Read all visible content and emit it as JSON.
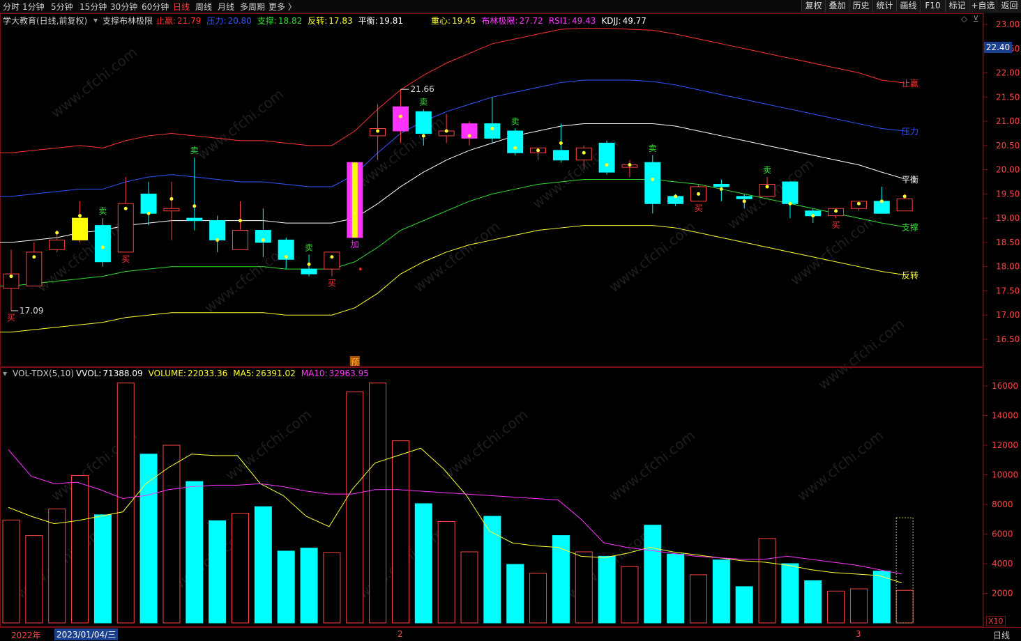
{
  "toolbar": {
    "periods": [
      "分时",
      "1分钟",
      "5分钟",
      "15分钟",
      "30分钟",
      "60分钟",
      "日线",
      "周线",
      "月线",
      "多周期",
      "更多 〉"
    ],
    "active_period": "日线",
    "right_buttons": [
      "复权",
      "叠加",
      "历史",
      "统计",
      "画线",
      "F10",
      "标记",
      "+自选",
      "返回"
    ]
  },
  "main_info": {
    "stock": "学大教育(日线,前复权)",
    "indicator": "支撑布林极限",
    "items": [
      {
        "label": "止赢:",
        "value": "21.79",
        "color": "#ff3333"
      },
      {
        "label": "压力:",
        "value": "20.80",
        "color": "#3355ff"
      },
      {
        "label": "支撑:",
        "value": "18.82",
        "color": "#33dd33"
      },
      {
        "label": "反转:",
        "value": "17.83",
        "color": "#ffff33"
      },
      {
        "label": "平衡:",
        "value": "19.81",
        "color": "#ffffff"
      }
    ],
    "items2": [
      {
        "label": "重心:",
        "value": "19.45",
        "color": "#ffff33"
      },
      {
        "label": "布林极限:",
        "value": "27.72",
        "color": "#ff33ff"
      },
      {
        "label": "RSI1:",
        "value": "49.43",
        "color": "#ff33ff"
      },
      {
        "label": "KDJJ:",
        "value": "49.77",
        "color": "#ffffff"
      }
    ]
  },
  "vol_info": {
    "name": "VOL-TDX(5,10)",
    "items": [
      {
        "label": "VVOL:",
        "value": "71388.09",
        "color": "#ffffff"
      },
      {
        "label": "VOLUME:",
        "value": "22033.36",
        "color": "#ffff33"
      },
      {
        "label": "MA5:",
        "value": "26391.02",
        "color": "#ffff33"
      },
      {
        "label": "MA10:",
        "value": "32963.95",
        "color": "#ff33ff"
      }
    ]
  },
  "line_labels": [
    {
      "text": "止赢",
      "color": "#ff3333"
    },
    {
      "text": "压力",
      "color": "#3355ff"
    },
    {
      "text": "平衡",
      "color": "#ffffff"
    },
    {
      "text": "支撑",
      "color": "#33dd33"
    },
    {
      "text": "反转",
      "color": "#ffff33"
    }
  ],
  "price_tag": "22.40",
  "x_axis": {
    "left": "2022年",
    "selected": "2023/01/04/三",
    "mid": "2",
    "right": "3",
    "period": "日线"
  },
  "vol_multiplier": "X10",
  "watermark": "www.cfchi.com",
  "chart_data": {
    "type": "candlestick",
    "price_axis": {
      "ticks": [
        16.5,
        17.0,
        17.5,
        18.0,
        18.5,
        19.0,
        19.5,
        20.0,
        20.5,
        21.0,
        21.5,
        22.0,
        22.5,
        23.0
      ],
      "range": [
        16.2,
        23.1
      ]
    },
    "volume_axis": {
      "ticks": [
        2000,
        4000,
        6000,
        8000,
        10000,
        12000,
        14000,
        16000
      ],
      "range": [
        0,
        16800
      ]
    },
    "annotations": {
      "high_label": "21.66",
      "low_label": "17.09"
    },
    "candles": [
      {
        "o": 17.55,
        "c": 17.85,
        "h": 18.35,
        "l": 17.09,
        "v": 6950
      },
      {
        "o": 17.6,
        "c": 18.3,
        "h": 18.5,
        "l": 17.6,
        "v": 5900
      },
      {
        "o": 18.35,
        "c": 18.55,
        "h": 18.75,
        "l": 18.3,
        "v": 7700
      },
      {
        "o": 18.55,
        "c": 19.0,
        "h": 19.35,
        "l": 18.5,
        "v": 9950
      },
      {
        "o": 18.85,
        "c": 18.1,
        "h": 19.0,
        "l": 18.0,
        "v": 7300
      },
      {
        "o": 18.3,
        "c": 19.3,
        "h": 19.85,
        "l": 18.3,
        "v": 16200
      },
      {
        "o": 19.5,
        "c": 19.1,
        "h": 19.75,
        "l": 18.85,
        "v": 11400
      },
      {
        "o": 19.15,
        "c": 19.2,
        "h": 19.75,
        "l": 18.55,
        "v": 12000
      },
      {
        "o": 19.0,
        "c": 18.95,
        "h": 20.25,
        "l": 18.75,
        "v": 9550
      },
      {
        "o": 18.95,
        "c": 18.55,
        "h": 19.05,
        "l": 18.3,
        "v": 6900
      },
      {
        "o": 18.35,
        "c": 18.75,
        "h": 19.35,
        "l": 18.35,
        "v": 7400
      },
      {
        "o": 18.75,
        "c": 18.5,
        "h": 19.2,
        "l": 18.2,
        "v": 7850
      },
      {
        "o": 18.55,
        "c": 18.15,
        "h": 18.6,
        "l": 17.95,
        "v": 4850
      },
      {
        "o": 17.95,
        "c": 17.85,
        "h": 18.25,
        "l": 17.8,
        "v": 5050
      },
      {
        "o": 17.95,
        "c": 18.3,
        "h": 18.3,
        "l": 17.8,
        "v": 4750
      },
      {
        "o": 18.6,
        "c": 20.15,
        "h": 20.15,
        "l": 18.6,
        "v": 15600
      },
      {
        "o": 20.7,
        "c": 20.85,
        "h": 21.35,
        "l": 20.2,
        "v": 16200
      },
      {
        "o": 20.8,
        "c": 21.3,
        "h": 21.66,
        "l": 20.55,
        "v": 12300
      },
      {
        "o": 21.2,
        "c": 20.75,
        "h": 21.25,
        "l": 20.5,
        "v": 8050
      },
      {
        "o": 20.7,
        "c": 20.8,
        "h": 21.15,
        "l": 20.55,
        "v": 6850
      },
      {
        "o": 20.65,
        "c": 20.95,
        "h": 21.0,
        "l": 20.5,
        "v": 4800
      },
      {
        "o": 20.95,
        "c": 20.65,
        "h": 21.5,
        "l": 20.55,
        "v": 7200
      },
      {
        "o": 20.8,
        "c": 20.35,
        "h": 20.85,
        "l": 20.3,
        "v": 3950
      },
      {
        "o": 20.35,
        "c": 20.45,
        "h": 20.45,
        "l": 20.2,
        "v": 3350
      },
      {
        "o": 20.4,
        "c": 20.2,
        "h": 20.95,
        "l": 20.15,
        "v": 5900
      },
      {
        "o": 20.2,
        "c": 20.45,
        "h": 20.5,
        "l": 20.0,
        "v": 4800
      },
      {
        "o": 20.55,
        "c": 19.95,
        "h": 20.6,
        "l": 19.9,
        "v": 4500
      },
      {
        "o": 20.05,
        "c": 20.1,
        "h": 20.2,
        "l": 19.85,
        "v": 3800
      },
      {
        "o": 20.15,
        "c": 19.3,
        "h": 20.3,
        "l": 19.1,
        "v": 6600
      },
      {
        "o": 19.45,
        "c": 19.3,
        "h": 19.5,
        "l": 19.25,
        "v": 4650
      },
      {
        "o": 19.35,
        "c": 19.65,
        "h": 19.7,
        "l": 19.35,
        "v": 3250
      },
      {
        "o": 19.7,
        "c": 19.65,
        "h": 19.8,
        "l": 19.35,
        "v": 4250
      },
      {
        "o": 19.45,
        "c": 19.4,
        "h": 19.5,
        "l": 19.2,
        "v": 2450
      },
      {
        "o": 19.45,
        "c": 19.7,
        "h": 19.85,
        "l": 19.45,
        "v": 5700
      },
      {
        "o": 19.75,
        "c": 19.3,
        "h": 19.75,
        "l": 19.0,
        "v": 4000
      },
      {
        "o": 19.15,
        "c": 19.05,
        "h": 19.2,
        "l": 18.9,
        "v": 2850
      },
      {
        "o": 19.05,
        "c": 19.2,
        "h": 19.2,
        "l": 19.0,
        "v": 2150
      },
      {
        "o": 19.2,
        "c": 19.35,
        "h": 19.35,
        "l": 19.15,
        "v": 2300
      },
      {
        "o": 19.35,
        "c": 19.1,
        "h": 19.65,
        "l": 19.1,
        "v": 3500
      },
      {
        "o": 19.15,
        "c": 19.4,
        "h": 19.5,
        "l": 19.15,
        "v": 2200
      }
    ],
    "markers": [
      {
        "i": 0,
        "text": "买",
        "color": "#ff3333",
        "pos": "below"
      },
      {
        "i": 4,
        "text": "卖",
        "color": "#33dd33",
        "pos": "above"
      },
      {
        "i": 5,
        "text": "买",
        "color": "#ff3333",
        "pos": "below"
      },
      {
        "i": 8,
        "text": "卖",
        "color": "#33dd33",
        "pos": "above"
      },
      {
        "i": 13,
        "text": "卖",
        "color": "#33dd33",
        "pos": "above"
      },
      {
        "i": 14,
        "text": "买",
        "color": "#ff3333",
        "pos": "below"
      },
      {
        "i": 15,
        "text": "加",
        "color": "#ff33ff",
        "pos": "below"
      },
      {
        "i": 15,
        "text": "预",
        "color": "#ffaa33",
        "pos": "axis"
      },
      {
        "i": 18,
        "text": "卖",
        "color": "#33dd33",
        "pos": "above"
      },
      {
        "i": 22,
        "text": "卖",
        "color": "#33dd33",
        "pos": "above"
      },
      {
        "i": 28,
        "text": "卖",
        "color": "#33dd33",
        "pos": "above"
      },
      {
        "i": 30,
        "text": "买",
        "color": "#ff3333",
        "pos": "below"
      },
      {
        "i": 33,
        "text": "卖",
        "color": "#33dd33",
        "pos": "above"
      },
      {
        "i": 36,
        "text": "买",
        "color": "#ff3333",
        "pos": "below"
      }
    ],
    "series": [
      {
        "name": "止赢",
        "color": "#ff3333",
        "values": [
          20.35,
          20.4,
          20.45,
          20.5,
          20.45,
          20.6,
          20.7,
          20.75,
          20.7,
          20.65,
          20.6,
          20.6,
          20.55,
          20.5,
          20.5,
          20.8,
          21.25,
          21.65,
          21.95,
          22.2,
          22.4,
          22.6,
          22.7,
          22.8,
          22.9,
          22.92,
          22.92,
          22.9,
          22.88,
          22.8,
          22.7,
          22.6,
          22.5,
          22.4,
          22.3,
          22.2,
          22.1,
          22.0,
          21.85,
          21.79
        ]
      },
      {
        "name": "压力",
        "color": "#3355ff",
        "values": [
          19.45,
          19.5,
          19.55,
          19.6,
          19.6,
          19.75,
          19.85,
          19.9,
          19.85,
          19.8,
          19.75,
          19.75,
          19.7,
          19.65,
          19.65,
          19.9,
          20.35,
          20.75,
          21.0,
          21.2,
          21.35,
          21.5,
          21.6,
          21.7,
          21.8,
          21.85,
          21.85,
          21.85,
          21.82,
          21.75,
          21.65,
          21.55,
          21.45,
          21.35,
          21.25,
          21.15,
          21.05,
          20.95,
          20.85,
          20.8
        ]
      },
      {
        "name": "平衡",
        "color": "#ffffff",
        "values": [
          18.5,
          18.55,
          18.6,
          18.7,
          18.75,
          18.85,
          18.9,
          18.95,
          18.95,
          18.95,
          18.95,
          18.95,
          18.9,
          18.9,
          18.9,
          19.0,
          19.3,
          19.65,
          19.95,
          20.2,
          20.4,
          20.55,
          20.7,
          20.8,
          20.9,
          20.95,
          20.95,
          20.95,
          20.95,
          20.9,
          20.8,
          20.7,
          20.6,
          20.5,
          20.4,
          20.3,
          20.2,
          20.1,
          19.95,
          19.81
        ]
      },
      {
        "name": "支撑",
        "color": "#33dd33",
        "values": [
          17.6,
          17.65,
          17.7,
          17.75,
          17.8,
          17.9,
          17.95,
          18.0,
          18.0,
          18.0,
          18.0,
          18.0,
          17.95,
          17.95,
          17.95,
          18.1,
          18.4,
          18.75,
          18.95,
          19.15,
          19.35,
          19.5,
          19.6,
          19.7,
          19.75,
          19.8,
          19.8,
          19.8,
          19.8,
          19.75,
          19.7,
          19.6,
          19.5,
          19.4,
          19.3,
          19.2,
          19.1,
          19.0,
          18.9,
          18.82
        ]
      },
      {
        "name": "反转",
        "color": "#ffff33",
        "values": [
          16.65,
          16.7,
          16.75,
          16.8,
          16.85,
          16.95,
          17.0,
          17.05,
          17.05,
          17.05,
          17.05,
          17.05,
          17.0,
          17.0,
          17.0,
          17.15,
          17.45,
          17.85,
          18.1,
          18.3,
          18.45,
          18.55,
          18.65,
          18.75,
          18.8,
          18.85,
          18.85,
          18.85,
          18.85,
          18.8,
          18.7,
          18.6,
          18.5,
          18.4,
          18.3,
          18.2,
          18.1,
          18.0,
          17.9,
          17.83
        ]
      },
      {
        "name": "重心",
        "color": "#ffff33",
        "values": [
          17.8,
          18.2,
          18.7,
          19.05,
          18.4,
          19.2,
          19.1,
          19.4,
          19.25,
          18.55,
          18.95,
          18.55,
          18.2,
          18.05,
          18.2,
          19.1,
          20.8,
          21.1,
          20.7,
          20.8,
          20.7,
          20.85,
          20.45,
          20.4,
          20.55,
          20.35,
          20.1,
          20.1,
          19.8,
          19.45,
          19.5,
          19.6,
          19.35,
          19.65,
          19.3,
          19.05,
          19.15,
          19.3,
          19.35,
          19.45
        ]
      }
    ],
    "volume_ma": [
      {
        "name": "MA5",
        "color": "#ffff33",
        "values": [
          7800,
          7200,
          6700,
          6900,
          7200,
          7500,
          9400,
          10500,
          11400,
          11300,
          11300,
          9400,
          8600,
          7200,
          6500,
          9000,
          10800,
          11300,
          11800,
          10400,
          8600,
          6200,
          5400,
          5200,
          5100,
          4500,
          4400,
          4700,
          5100,
          4800,
          4600,
          4400,
          4200,
          4100,
          3900,
          3600,
          3400,
          3300,
          3200,
          2700
        ]
      },
      {
        "name": "MA10",
        "color": "#ff33ff",
        "values": [
          11700,
          9900,
          9400,
          9500,
          9000,
          8400,
          8600,
          9000,
          9200,
          9300,
          9300,
          9400,
          9200,
          8900,
          8700,
          8700,
          9000,
          9000,
          8900,
          8800,
          8700,
          8600,
          8500,
          8400,
          8300,
          7000,
          5400,
          5100,
          4900,
          4700,
          4500,
          4400,
          4300,
          4300,
          4500,
          4300,
          4100,
          3900,
          3600,
          3300
        ]
      }
    ]
  }
}
